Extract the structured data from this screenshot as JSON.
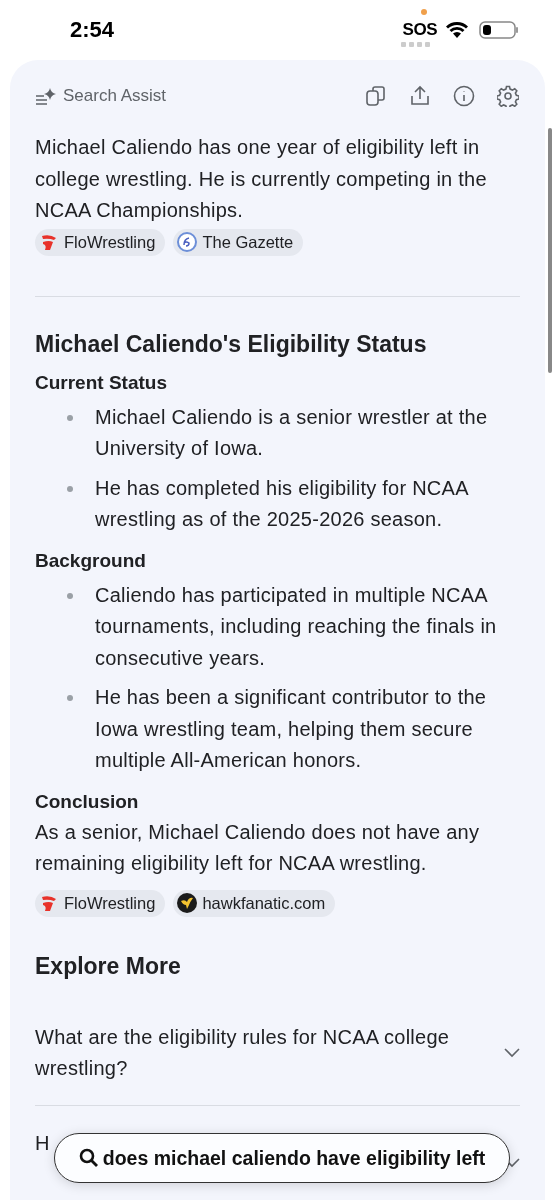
{
  "status_bar": {
    "time": "2:54",
    "carrier": "SOS"
  },
  "header": {
    "title": "Search Assist"
  },
  "summary": {
    "text": "Michael Caliendo has one year of eligibility left in college wrestling. He is currently competing in the NCAA Championships.",
    "sources": [
      {
        "name": "FloWrestling",
        "kind": "flo"
      },
      {
        "name": "The Gazette",
        "kind": "gazette"
      }
    ]
  },
  "article": {
    "title": "Michael Caliendo's Eligibility Status",
    "sections": [
      {
        "heading": "Current Status",
        "kind": "bullets",
        "items": [
          "Michael Caliendo is a senior wrestler at the University of Iowa.",
          "He has completed his eligibility for NCAA wrestling as of the 2025-2026 season."
        ]
      },
      {
        "heading": "Background",
        "kind": "bullets",
        "items": [
          "Caliendo has participated in multiple NCAA tournaments, including reaching the finals in consecutive years.",
          "He has been a significant contributor to the Iowa wrestling team, helping them secure multiple All-American honors."
        ]
      },
      {
        "heading": "Conclusion",
        "kind": "paragraph",
        "items": [
          "As a senior, Michael Caliendo does not have any remaining eligibility left for NCAA wrestling."
        ]
      }
    ],
    "sources": [
      {
        "name": "FloWrestling",
        "kind": "flo"
      },
      {
        "name": "hawkfanatic.com",
        "kind": "hawk"
      }
    ]
  },
  "explore": {
    "title": "Explore More",
    "questions": [
      {
        "lines": [
          "What are the eligibility rules for NCAA college wrestling?"
        ],
        "expanded": false
      },
      {
        "lines": [
          "H"
        ],
        "expanded": false
      }
    ]
  },
  "search_pill": {
    "query": "does michael caliendo have eligibility left"
  }
}
